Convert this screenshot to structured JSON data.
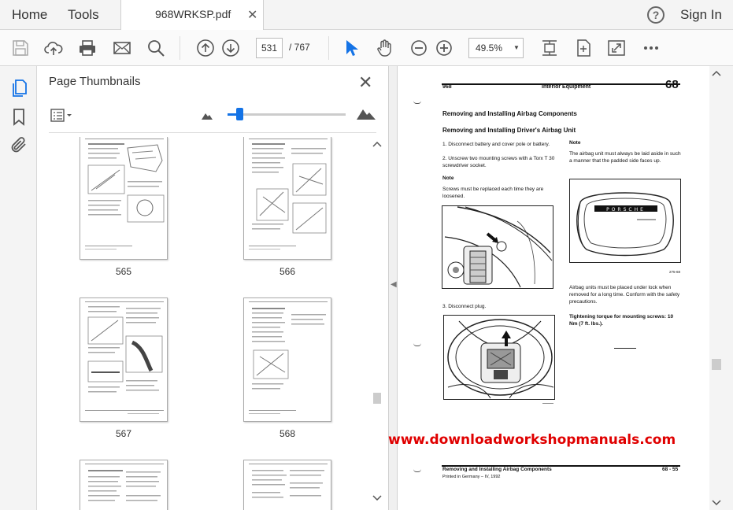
{
  "menu": {
    "home": "Home",
    "tools": "Tools",
    "sign_in": "Sign In",
    "help": "?"
  },
  "tab": {
    "title": "968WRKSP.pdf",
    "close": "✕"
  },
  "toolbar": {
    "current_page": "531",
    "total_pages": "/ 767",
    "zoom": "49.5%"
  },
  "panel": {
    "title": "Page Thumbnails",
    "close": "✕",
    "slider_level": 0.1,
    "thumbnails": [
      {
        "label": "565"
      },
      {
        "label": "566"
      },
      {
        "label": "567"
      },
      {
        "label": "568"
      },
      {
        "label": ""
      },
      {
        "label": ""
      }
    ]
  },
  "page": {
    "header_left": "968",
    "header_center": "Interior Equipment",
    "header_right": "68",
    "section_title": "Removing and Installing Airbag Components",
    "subsection_title": "Removing and Installing Driver's Airbag Unit",
    "step1": "1. Disconnect battery and cover pole or battery.",
    "step2": "2. Unscrew two mounting screws with a Torx T 30 screwdriver socket.",
    "note_label": "Note",
    "note_text": "Screws must be replaced each time they are loosened.",
    "step3": "3. Disconnect plug.",
    "right_note_label": "Note",
    "right_note_text": "The airbag unit must always be laid aside in such a manner that the padded side faces up.",
    "fig_code": "275-68",
    "storage_text": "Airbag units must be placed under lock when removed for a long time. Conform with the safety precautions.",
    "torque_text": "Tightening torque for mounting screws: 10 Nm (7 ft. lbs.).",
    "footer_left": "Removing and Installing Airbag Components",
    "footer_right": "68 - 55",
    "footer_printed": "Printed in Germany – IV, 1992"
  },
  "watermark": "www.downloadworkshopmanuals.com"
}
